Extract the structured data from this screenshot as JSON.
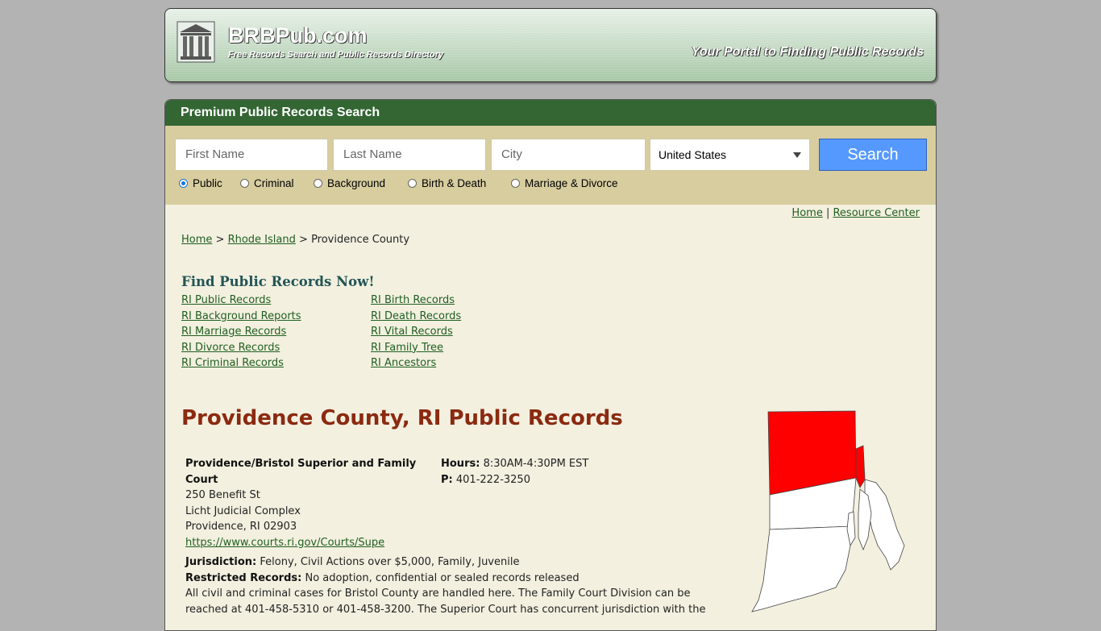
{
  "header": {
    "site_name": "BRBPub.com",
    "tagline": "Free Records Search and Public Records Directory",
    "portal_text": "Your Portal to Finding Public Records"
  },
  "panel": {
    "title": "Premium Public Records Search"
  },
  "search": {
    "first_name_placeholder": "First Name",
    "last_name_placeholder": "Last Name",
    "city_placeholder": "City",
    "country_selected": "United States",
    "button_label": "Search",
    "radios": [
      {
        "label": "Public",
        "checked": true
      },
      {
        "label": "Criminal",
        "checked": false
      },
      {
        "label": "Background",
        "checked": false
      },
      {
        "label": "Birth & Death",
        "checked": false
      },
      {
        "label": "Marriage & Divorce",
        "checked": false
      }
    ]
  },
  "top_links": {
    "home": "Home",
    "separator": "|",
    "resource_center": "Resource Center"
  },
  "breadcrumb": {
    "home": "Home",
    "sep1": ">",
    "state": "Rhode Island",
    "sep2": ">",
    "current": "Providence County"
  },
  "find_records": {
    "title": "Find Public Records Now!",
    "left_links": [
      "RI Public Records",
      "RI Background Reports",
      "RI Marriage Records",
      "RI Divorce Records",
      "RI Criminal Records"
    ],
    "right_links": [
      "RI Birth Records",
      "RI Death Records",
      "RI Vital Records",
      "RI Family Tree",
      "RI Ancestors"
    ]
  },
  "county_title": "Providence County, RI Public Records",
  "court": {
    "name": "Providence/Bristol Superior and Family Court",
    "address1": "250 Benefit St",
    "address2": "Licht Judicial Complex",
    "address3": "Providence, RI 02903",
    "url": "https://www.courts.ri.gov/Courts/Supe",
    "hours_label": "Hours:",
    "hours_value": "8:30AM-4:30PM EST",
    "phone_label": "P:",
    "phone_value": "401-222-3250",
    "jurisdiction_label": "Jurisdiction:",
    "jurisdiction_value": "Felony, Civil Actions over $5,000, Family, Juvenile",
    "restricted_label": "Restricted Records:",
    "restricted_value": "No adoption, confidential or sealed records released",
    "description_line1": "All civil and criminal cases for Bristol County are handled here. The Family Court Division can be",
    "description_line2": "reached at 401-458-5310 or 401-458-3200. The Superior Court has concurrent jurisdiction with the"
  },
  "colors": {
    "panel_header": "#336633",
    "search_bar": "#d8cd9f",
    "button": "#5599ff",
    "title_red": "#8b2a10",
    "map_highlight": "#ff0000"
  }
}
